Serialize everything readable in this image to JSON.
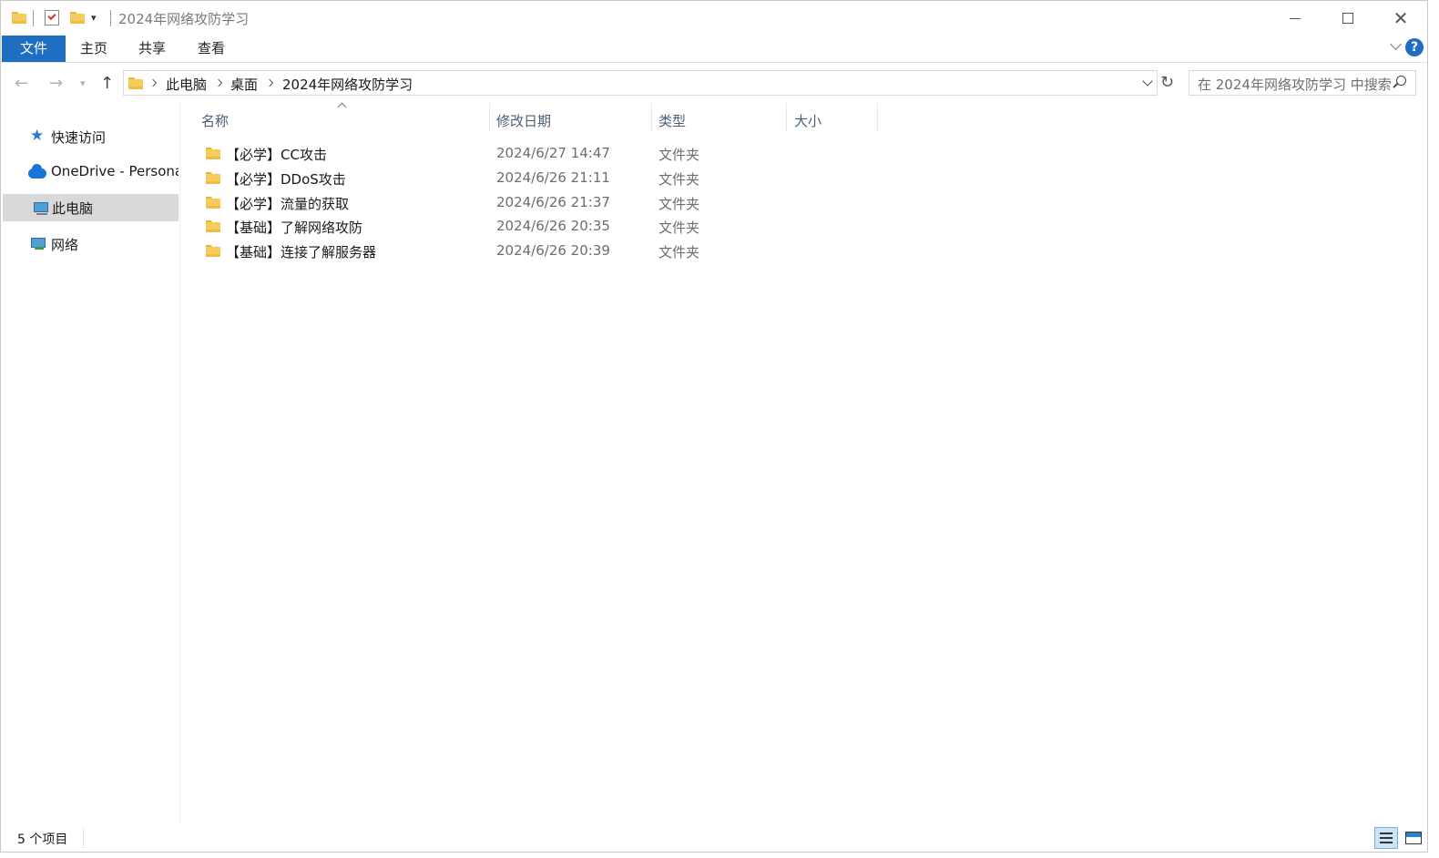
{
  "titlebar": {
    "title": "2024年网络攻防学习",
    "quick_access_icons": [
      "folder-icon",
      "properties-checkmark-icon",
      "new-folder-icon",
      "customize-dropdown-icon"
    ]
  },
  "ribbon": {
    "tabs": [
      {
        "label": "文件"
      },
      {
        "label": "主页"
      },
      {
        "label": "共享"
      },
      {
        "label": "查看"
      }
    ],
    "help_label": "?"
  },
  "address": {
    "crumbs": [
      "此电脑",
      "桌面",
      "2024年网络攻防学习"
    ]
  },
  "search": {
    "placeholder": "在 2024年网络攻防学习 中搜索"
  },
  "sidebar": {
    "items": [
      {
        "label": "快速访问",
        "icon": "star-icon"
      },
      {
        "label": "OneDrive - Persona",
        "icon": "cloud-icon"
      },
      {
        "label": "此电脑",
        "icon": "pc-icon",
        "selected": true
      },
      {
        "label": "网络",
        "icon": "network-icon"
      }
    ]
  },
  "list": {
    "columns": [
      "名称",
      "修改日期",
      "类型",
      "大小"
    ],
    "rows": [
      {
        "name": "【必学】CC攻击",
        "date": "2024/6/27 14:47",
        "type": "文件夹"
      },
      {
        "name": "【必学】DDoS攻击",
        "date": "2024/6/26 21:11",
        "type": "文件夹"
      },
      {
        "name": "【必学】流量的获取",
        "date": "2024/6/26 21:37",
        "type": "文件夹"
      },
      {
        "name": "【基础】了解网络攻防",
        "date": "2024/6/26 20:35",
        "type": "文件夹"
      },
      {
        "name": "【基础】连接了解服务器",
        "date": "2024/6/26 20:39",
        "type": "文件夹"
      }
    ]
  },
  "status": {
    "count": "5 个项目"
  },
  "colors": {
    "accent": "#1e6ec1",
    "header_text": "#4c607a",
    "selected_bg": "#d9d9d9",
    "folder": "#f6cd58"
  }
}
